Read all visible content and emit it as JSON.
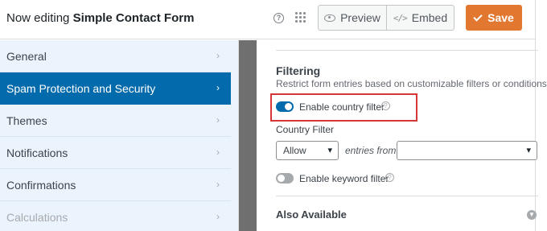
{
  "header": {
    "editing_prefix": "Now editing",
    "form_name": "Simple Contact Form",
    "help_icon": "question-circle-icon",
    "apps_icon": "grid-dots-icon",
    "preview_label": "Preview",
    "embed_label": "Embed",
    "save_label": "Save",
    "save_color": "#e27730"
  },
  "sidebar": {
    "items": [
      {
        "label": "General",
        "active": false
      },
      {
        "label": "Spam Protection and Security",
        "active": true
      },
      {
        "label": "Themes",
        "active": false
      },
      {
        "label": "Notifications",
        "active": false
      },
      {
        "label": "Confirmations",
        "active": false
      },
      {
        "label": "Calculations",
        "active": false
      }
    ],
    "active_color": "#036aab"
  },
  "main": {
    "section_title": "Filtering",
    "section_description": "Restrict form entries based on customizable filters or conditions.",
    "country_filter_toggle": {
      "label": "Enable country filter",
      "on": true
    },
    "country_filter_label": "Country Filter",
    "country_select_value": "Allow",
    "entries_from_text": "entries from",
    "countries_select_value": "",
    "keyword_filter_toggle": {
      "label": "Enable keyword filter",
      "on": false
    },
    "also_available": "Also Available",
    "highlight_color": "#d63638"
  }
}
